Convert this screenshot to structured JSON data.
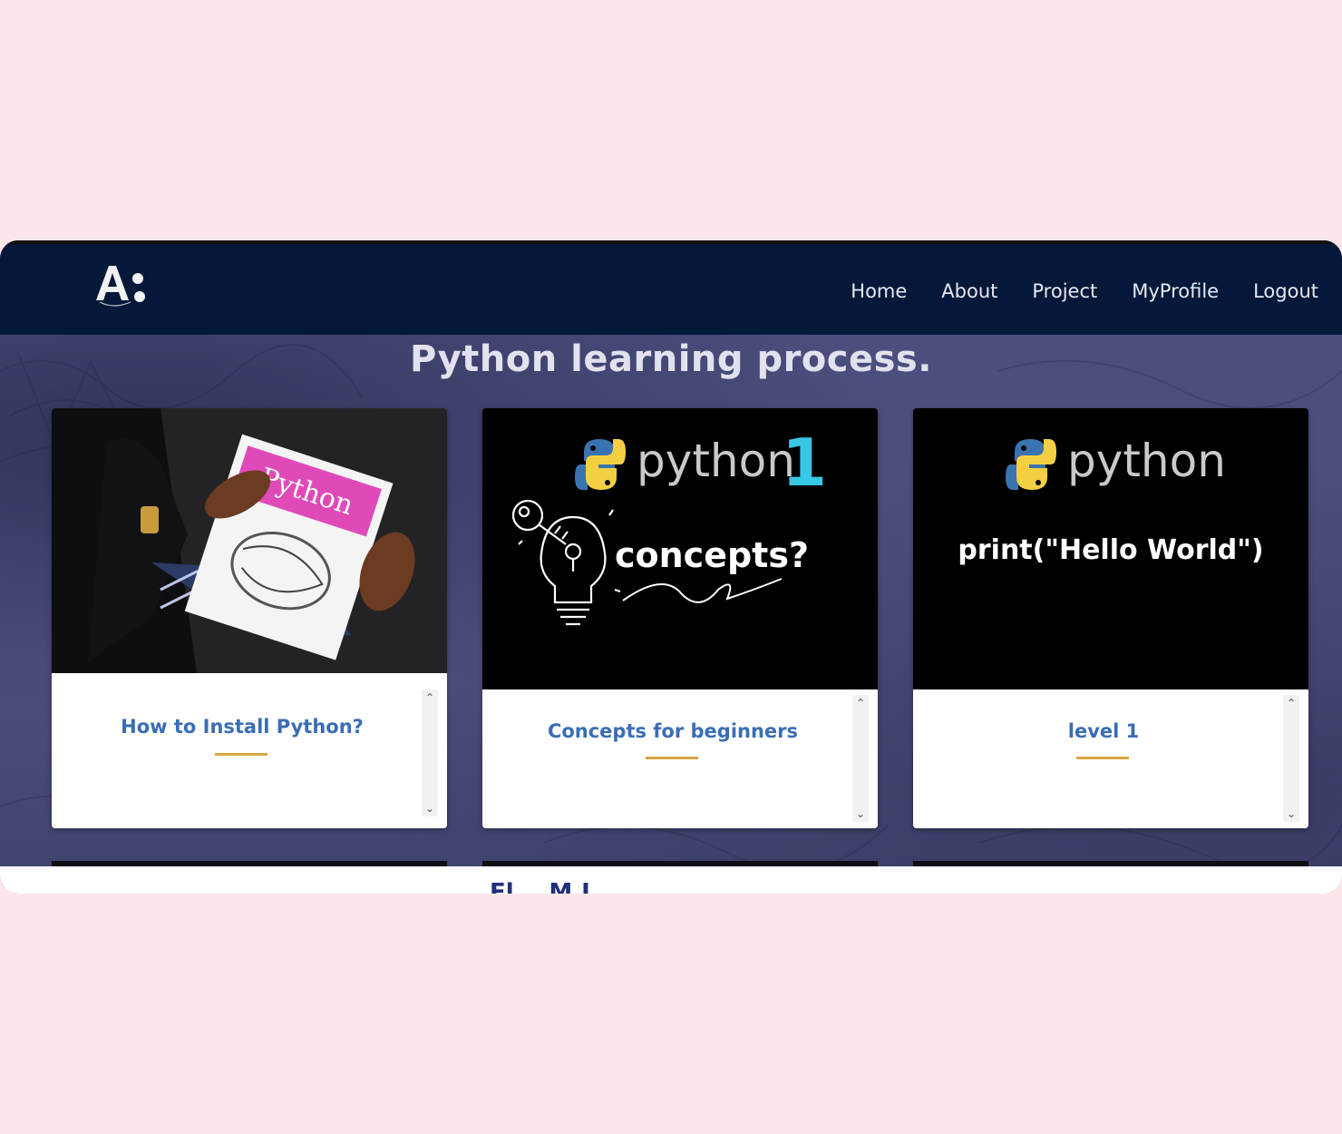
{
  "logo": {
    "alt": "A:"
  },
  "nav": {
    "items": [
      "Home",
      "About",
      "Project",
      "MyProfile",
      "Logout"
    ]
  },
  "main": {
    "title": "Python learning process."
  },
  "cards": [
    {
      "title": "How to Install Python?",
      "image": {
        "book_title": "Python"
      }
    },
    {
      "title": "Concepts for beginners",
      "image": {
        "brand": "python",
        "badge": "1",
        "caption": "concepts?"
      }
    },
    {
      "title": "level 1",
      "image": {
        "brand": "python",
        "code": "print(\"Hello World\")"
      }
    }
  ],
  "footer": {
    "partial_text": "Fl... M.J..."
  },
  "colors": {
    "topbar": "#04193a",
    "card_title": "#3a6db6",
    "underline_accent": "#d9a640",
    "page_background": "#fde6ea"
  }
}
